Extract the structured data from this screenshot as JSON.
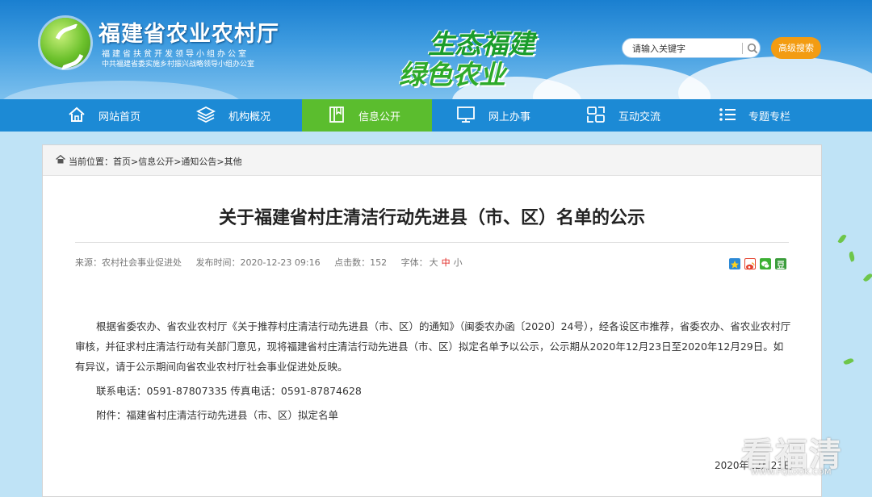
{
  "header": {
    "site_title": "福建省农业农村厅",
    "subtitle1": "福建省扶贫开发领导小组办公室",
    "subtitle2": "中共福建省委实施乡村振兴战略领导小组办公室",
    "slogan_line1": "生态福建",
    "slogan_line2": "绿色农业",
    "search_placeholder": "请输入关键字",
    "advanced_search": "高级搜索"
  },
  "nav": {
    "items": [
      {
        "label": "网站首页",
        "icon": "home-icon"
      },
      {
        "label": "机构概况",
        "icon": "layers-icon"
      },
      {
        "label": "信息公开",
        "icon": "book-icon"
      },
      {
        "label": "网上办事",
        "icon": "monitor-icon"
      },
      {
        "label": "互动交流",
        "icon": "chat-icon"
      },
      {
        "label": "专题专栏",
        "icon": "list-icon"
      }
    ],
    "active": "信息公开"
  },
  "breadcrumb": {
    "text": "当前位置：首页>信息公开>通知公告>其他"
  },
  "article": {
    "title": "关于福建省村庄清洁行动先进县（市、区）名单的公示",
    "source": "来源：农村社会事业促进处",
    "published": "发布时间：2020-12-23 09:16",
    "hits": "点击数：152",
    "font_size_label": "字体：",
    "font_large": "大",
    "font_medium": "中",
    "font_small": "小",
    "paragraph1": "根据省委农办、省农业农村厅《关于推荐村庄清洁行动先进县（市、区）的通知》（闽委农办函〔2020〕24号），经各设区市推荐，省委农办、省农业农村厅审核，并征求村庄清洁行动有关部门意见，现将福建省村庄清洁行动先进县（市、区）拟定名单予以公示，公示期从2020年12月23日至2020年12月29日。如有异议，请于公示期间向省农业农村厅社会事业促进处反映。",
    "contact": "联系电话：0591-87807335 传真电话：0591-87874628",
    "attachment": "附件：福建省村庄清洁行动先进县（市、区）拟定名单",
    "date": "2020年12月23日"
  },
  "share_icons": [
    "qzone-icon",
    "weibo-icon",
    "wechat-icon",
    "douban-icon"
  ],
  "watermark": {
    "text": "看福清",
    "url": "WWW.FQLOOK.COM"
  },
  "colors": {
    "header_blue": "#1a7fd0",
    "nav_blue": "#1c8ad5",
    "nav_active_green": "#5bbd2e",
    "adv_search_orange": "#f39c12",
    "font_active_red": "#e0201c"
  }
}
